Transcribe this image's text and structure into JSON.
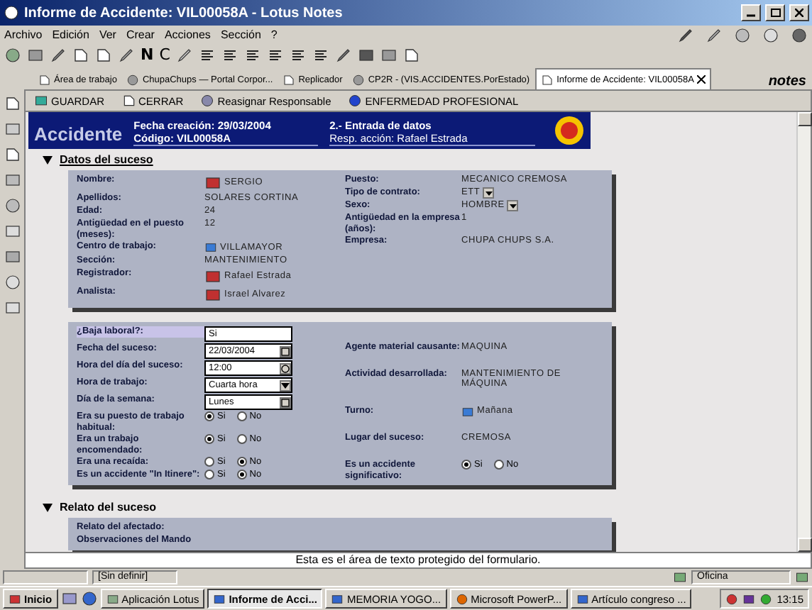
{
  "window": {
    "title": "Informe de Accidente: VIL00058A - Lotus Notes"
  },
  "menu": [
    "Archivo",
    "Edición",
    "Ver",
    "Crear",
    "Acciones",
    "Sección",
    "?"
  ],
  "format_letters": [
    "N",
    "C"
  ],
  "tabs": [
    {
      "label": "Área de trabajo",
      "selected": false
    },
    {
      "label": "ChupaChups — Portal Corpor...",
      "selected": false
    },
    {
      "label": "Replicador",
      "selected": false
    },
    {
      "label": "CP2R - (VIS.ACCIDENTES.PorEstado)",
      "selected": false
    },
    {
      "label": "Informe de Accidente: VIL00058A",
      "selected": true
    }
  ],
  "brand": "notes",
  "actions": [
    "GUARDAR",
    "CERRAR",
    "Reasignar Responsable",
    "ENFERMEDAD PROFESIONAL"
  ],
  "banner": {
    "title": "Accidente",
    "created": "Fecha creación: 29/03/2004",
    "code": "Código: VIL00058A",
    "stage": "2.- Entrada de datos",
    "owner": "Resp. acción: Rafael Estrada"
  },
  "sections": [
    {
      "title": "Datos del suceso",
      "expanded": true,
      "left": [
        {
          "label": "Nombre:",
          "kind": "person",
          "value": "SERGIO"
        },
        {
          "label": "Apellidos:",
          "kind": "text",
          "value": "SOLARES CORTINA"
        },
        {
          "label": "Edad:",
          "kind": "text",
          "value": "24"
        },
        {
          "label": "Antigüedad en el puesto (meses):",
          "kind": "text",
          "value": "12"
        },
        {
          "label": "Centro de trabajo:",
          "kind": "picker",
          "value": "VILLAMAYOR"
        },
        {
          "label": "Sección:",
          "kind": "text",
          "value": "MANTENIMIENTO"
        },
        {
          "label": "Registrador:",
          "kind": "person",
          "value": "Rafael Estrada"
        },
        {
          "label": "Analista:",
          "kind": "person",
          "value": "Israel Alvarez"
        }
      ],
      "right": [
        {
          "label": "Puesto:",
          "kind": "text",
          "value": "MECANICO CREMOSA"
        },
        {
          "label": "Tipo de contrato:",
          "kind": "dropdown",
          "value": "ETT"
        },
        {
          "label": "Sexo:",
          "kind": "dropdown",
          "value": "HOMBRE"
        },
        {
          "label": "Antigüedad en la empresa (años):",
          "kind": "text",
          "value": "1"
        },
        {
          "label": "Empresa:",
          "kind": "text",
          "value": "CHUPA CHUPS S.A."
        }
      ]
    },
    {
      "expanded": true,
      "left": [
        {
          "label": "¿Baja laboral?:",
          "kind": "input",
          "value": "Si",
          "highlighted": true
        },
        {
          "label": "Fecha del suceso:",
          "kind": "date",
          "value": "22/03/2004"
        },
        {
          "label": "Hora del día del suceso:",
          "kind": "time",
          "value": "12:00"
        },
        {
          "label": "Hora de trabajo:",
          "kind": "select",
          "value": "Cuarta hora"
        },
        {
          "label": "Día de la semana:",
          "kind": "date",
          "value": "Lunes"
        },
        {
          "label": "Era su puesto de trabajo habitual:",
          "kind": "radio",
          "options": [
            {
              "label": "Si",
              "selected": true
            },
            {
              "label": "No",
              "selected": false
            }
          ]
        },
        {
          "label": "Era un trabajo encomendado:",
          "kind": "radio",
          "options": [
            {
              "label": "Si",
              "selected": true
            },
            {
              "label": "No",
              "selected": false
            }
          ]
        },
        {
          "label": "Era una recaída:",
          "kind": "radio",
          "options": [
            {
              "label": "Si",
              "selected": false
            },
            {
              "label": "No",
              "selected": true
            }
          ]
        },
        {
          "label": "Es un accidente \"In Itinere\":",
          "kind": "radio",
          "options": [
            {
              "label": "Si",
              "selected": false
            },
            {
              "label": "No",
              "selected": true
            }
          ]
        }
      ],
      "right": [
        {
          "label": "Agente material causante:",
          "kind": "text",
          "value": "MAQUINA"
        },
        {
          "label": "Actividad desarrollada:",
          "kind": "text",
          "value": "MANTENIMIENTO DE MÁQUINA"
        },
        {
          "label": "Turno:",
          "kind": "picker",
          "value": "Mañana"
        },
        {
          "label": "Lugar del suceso:",
          "kind": "text",
          "value": "CREMOSA"
        },
        {
          "label": "Es un accidente significativo:",
          "kind": "radio",
          "options": [
            {
              "label": "Si",
              "selected": true
            },
            {
              "label": "No",
              "selected": false
            }
          ]
        }
      ]
    },
    {
      "title": "Relato del suceso",
      "expanded": true,
      "left": [
        {
          "label": "Relato del afectado:",
          "kind": "text"
        },
        {
          "label": "Observaciones del Mando",
          "kind": "text"
        }
      ]
    }
  ],
  "message": "Esta es el área de texto protegido del formulario.",
  "status": {
    "category": "[Sin definir]",
    "location": "Oficina"
  },
  "taskbar": {
    "start": "Inicio",
    "items": [
      {
        "label": "Aplicación Lotus",
        "selected": false
      },
      {
        "label": "Informe de Acci...",
        "selected": true
      },
      {
        "label": "MEMORIA YOGO...",
        "selected": false
      },
      {
        "label": "Microsoft PowerP...",
        "selected": false
      },
      {
        "label": "Artículo congreso ...",
        "selected": false
      }
    ],
    "clock": "13:15"
  }
}
